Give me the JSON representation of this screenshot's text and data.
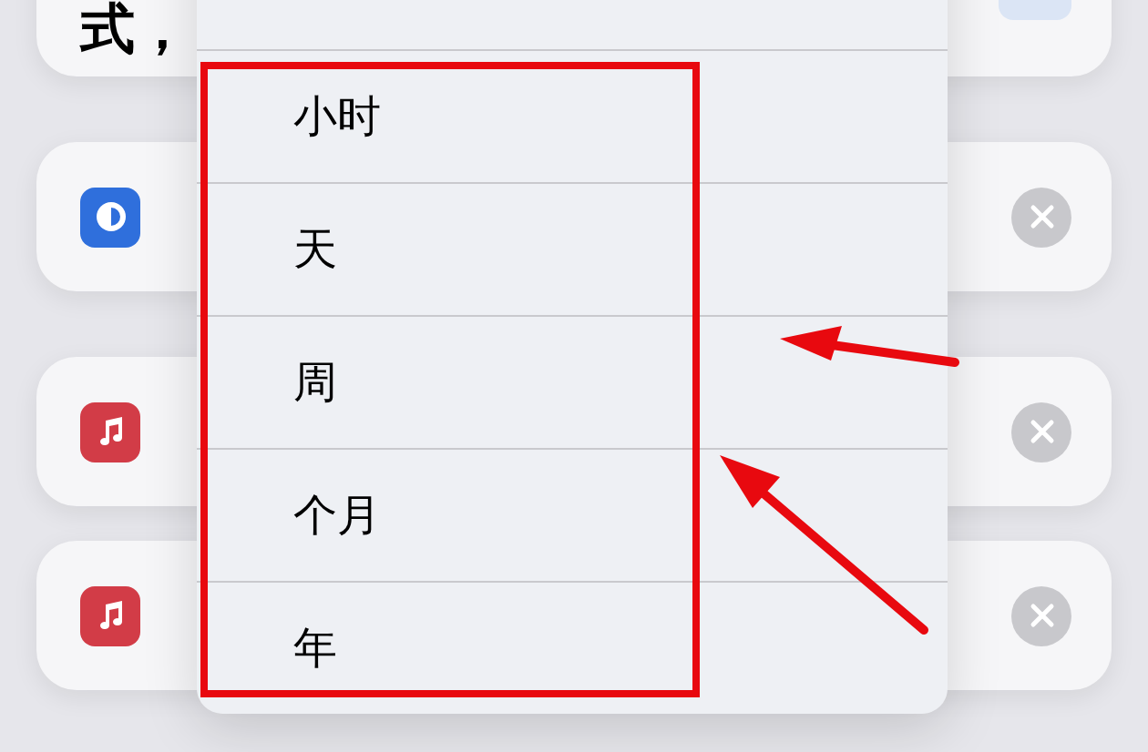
{
  "cards": [
    {
      "kind": "text",
      "text": "式，"
    },
    {
      "kind": "blue-app"
    },
    {
      "kind": "music-app"
    },
    {
      "kind": "music-app"
    }
  ],
  "menu": {
    "options": [
      {
        "label": "小时",
        "selected": false
      },
      {
        "label": "天",
        "selected": false
      },
      {
        "label": "周",
        "selected": false
      },
      {
        "label": "个月",
        "selected": false
      },
      {
        "label": "年",
        "selected": false
      }
    ]
  }
}
